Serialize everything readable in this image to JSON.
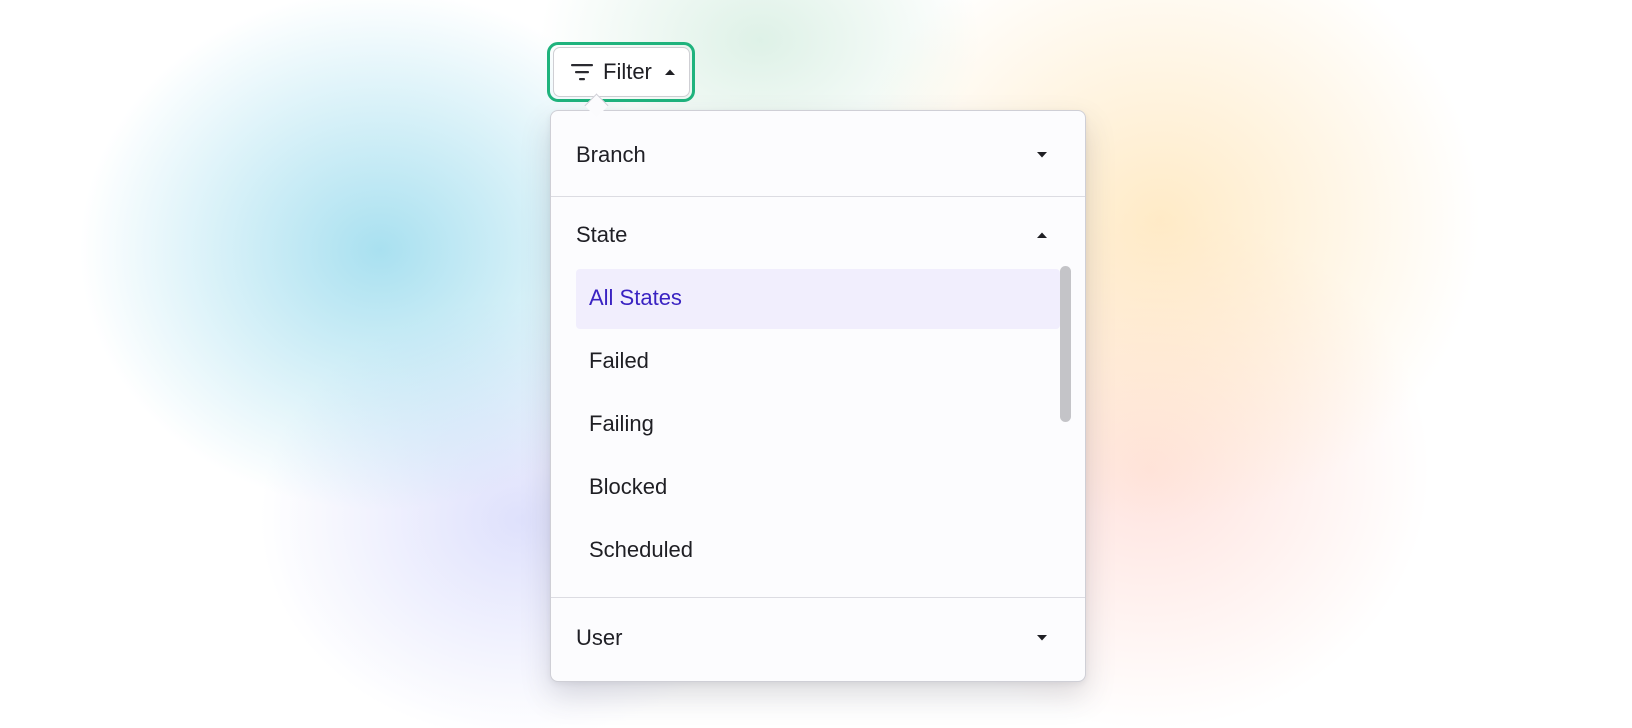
{
  "filter_button": {
    "label": "Filter",
    "icon": "filter-lines-icon",
    "caret": "caret-up-icon",
    "focus_color": "#1fb37d"
  },
  "dropdown": {
    "sections": [
      {
        "label": "Branch",
        "expanded": false,
        "caret": "caret-down-icon"
      },
      {
        "label": "State",
        "expanded": true,
        "caret": "caret-up-icon"
      },
      {
        "label": "User",
        "expanded": false,
        "caret": "caret-down-icon"
      }
    ],
    "state_options": [
      {
        "label": "All States",
        "selected": true
      },
      {
        "label": "Failed",
        "selected": false
      },
      {
        "label": "Failing",
        "selected": false
      },
      {
        "label": "Blocked",
        "selected": false
      },
      {
        "label": "Scheduled",
        "selected": false
      }
    ]
  },
  "colors": {
    "selected_text": "#3a23c2",
    "selected_bg": "#f1eefd",
    "text": "#1f1f24"
  }
}
